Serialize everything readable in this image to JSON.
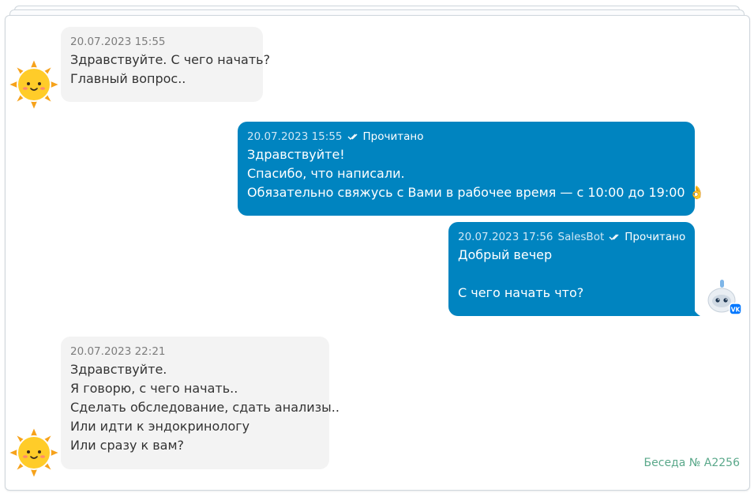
{
  "messages": [
    {
      "timestamp": "20.07.2023 15:55",
      "lines": [
        "Здравствуйте. С чего начать?",
        "Главный вопрос.."
      ]
    },
    {
      "timestamp": "20.07.2023 15:55",
      "status": "Прочитано",
      "lines": [
        "Здравствуйте!",
        "Спасибо, что написали.",
        "Обязательно свяжусь с Вами в рабочее время — с 10:00 до 19:00"
      ],
      "emoji": "👌"
    },
    {
      "timestamp": "20.07.2023 17:56",
      "sender": "SalesBot",
      "status": "Прочитано",
      "lines": [
        "Добрый вечер",
        "",
        "С чего начать что?"
      ],
      "badge": "VK"
    },
    {
      "timestamp": "20.07.2023 22:21",
      "lines": [
        "Здравствуйте.",
        "Я говорю, с чего начать..",
        "Сделать обследование, сдать анализы..",
        "Или идти к эндокринологу",
        "Или сразу к вам?"
      ]
    }
  ],
  "conversation_label": "Беседа № A2256",
  "icons": {
    "client_avatar": "sun-avatar-icon",
    "bot_avatar": "robot-avatar-icon",
    "read_status": "double-check-icon"
  },
  "colors": {
    "outgoing_bubble": "#0084c0",
    "incoming_bubble": "#f3f3f3",
    "footer_text": "#5aa88a"
  }
}
